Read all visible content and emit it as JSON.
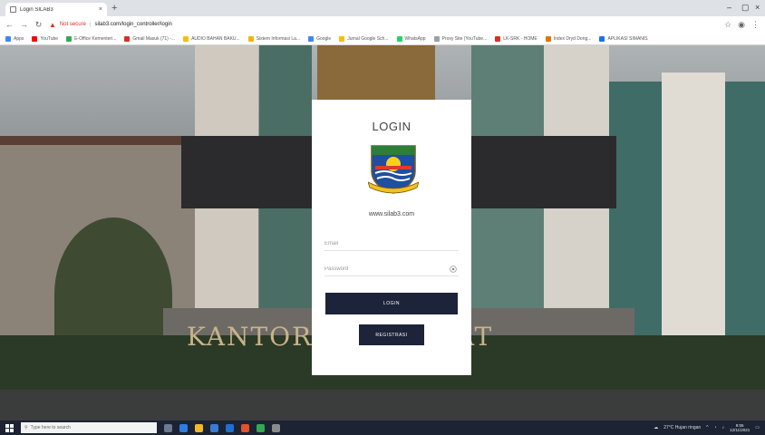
{
  "browser": {
    "tab_title": "Login SILAB3",
    "tab_close": "×",
    "new_tab": "+",
    "security_label": "Not secure",
    "url": "silab3.com/login_controller/login",
    "bookmarks": [
      {
        "label": "Apps",
        "color": "#4285f4"
      },
      {
        "label": "YouTube",
        "color": "#ff0000"
      },
      {
        "label": "E-Office Kementeri...",
        "color": "#34a853"
      },
      {
        "label": "Gmail Masuk (71) -...",
        "color": "#d93025"
      },
      {
        "label": "AUDIO BAHAN BAKU...",
        "color": "#fbbc05"
      },
      {
        "label": "Sistem Informasi La...",
        "color": "#f4b400"
      },
      {
        "label": "Google",
        "color": "#4285f4"
      },
      {
        "label": "Jurnal Google Sch...",
        "color": "#fbbc05"
      },
      {
        "label": "WhatsApp",
        "color": "#25d366"
      },
      {
        "label": "Proxy Site (YouTube...",
        "color": "#9aa0a6"
      },
      {
        "label": "LK-SRK - HOME",
        "color": "#d93025"
      },
      {
        "label": "Index Dryd Dong...",
        "color": "#e37400"
      },
      {
        "label": "APLIKASI SIMANIS",
        "color": "#1a73e8"
      }
    ]
  },
  "login": {
    "title": "LOGIN",
    "site_url": "www.silab3.com",
    "email_placeholder": "Email",
    "password_placeholder": "Password",
    "login_button": "LOGIN",
    "register_button": "REGISTRASI"
  },
  "background": {
    "sign_text": "KANTOR  ...  G BARAT"
  },
  "taskbar": {
    "search_placeholder": "Type here to search",
    "weather": "27°C  Hujan ringan",
    "time": "9:55",
    "date": "12/11/2021"
  },
  "colors": {
    "button_bg": "#1d2338",
    "card_bg": "#ffffff",
    "not_secure": "#d93025"
  }
}
